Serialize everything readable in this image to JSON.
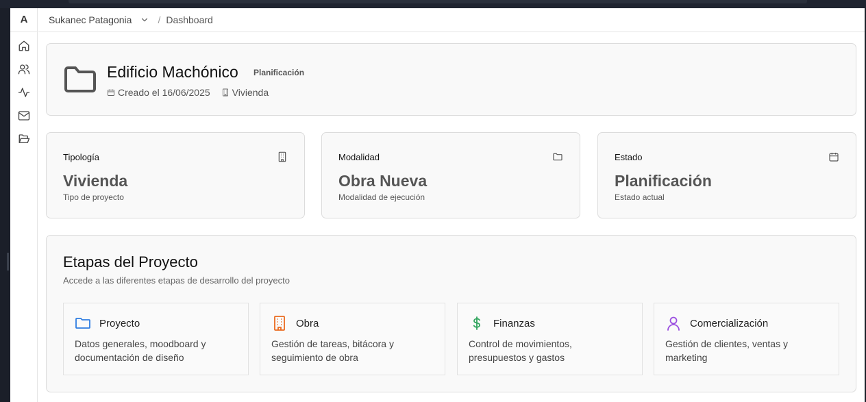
{
  "sidebar": {
    "logo": "A",
    "icons": [
      "home-icon",
      "users-icon",
      "activity-icon",
      "mail-icon",
      "folder-open-icon"
    ]
  },
  "header": {
    "org": "Sukanec Patagonia",
    "separator": "/",
    "crumb": "Dashboard"
  },
  "project": {
    "title": "Edificio Machónico",
    "badge": "Planificación",
    "created": "Creado el 16/06/2025",
    "type": "Vivienda"
  },
  "stats": [
    {
      "label": "Tipología",
      "value": "Vivienda",
      "sub": "Tipo de proyecto",
      "icon": "building-icon"
    },
    {
      "label": "Modalidad",
      "value": "Obra Nueva",
      "sub": "Modalidad de ejecución",
      "icon": "folder-icon"
    },
    {
      "label": "Estado",
      "value": "Planificación",
      "sub": "Estado actual",
      "icon": "calendar-icon"
    }
  ],
  "stages": {
    "title": "Etapas del Proyecto",
    "desc": "Accede a las diferentes etapas de desarrollo del proyecto",
    "items": [
      {
        "name": "Proyecto",
        "desc": "Datos generales, moodboard y documentación de diseño",
        "icon": "folder-icon",
        "color": "#2f7de1"
      },
      {
        "name": "Obra",
        "desc": "Gestión de tareas, bitácora y seguimiento de obra",
        "icon": "building-icon",
        "color": "#ea6a1f"
      },
      {
        "name": "Finanzas",
        "desc": "Control de movimientos, presupuestos y gastos",
        "icon": "dollar-icon",
        "color": "#2fa45c"
      },
      {
        "name": "Comercialización",
        "desc": "Gestión de clientes, ventas y marketing",
        "icon": "user-icon",
        "color": "#9b4fe0"
      }
    ]
  }
}
